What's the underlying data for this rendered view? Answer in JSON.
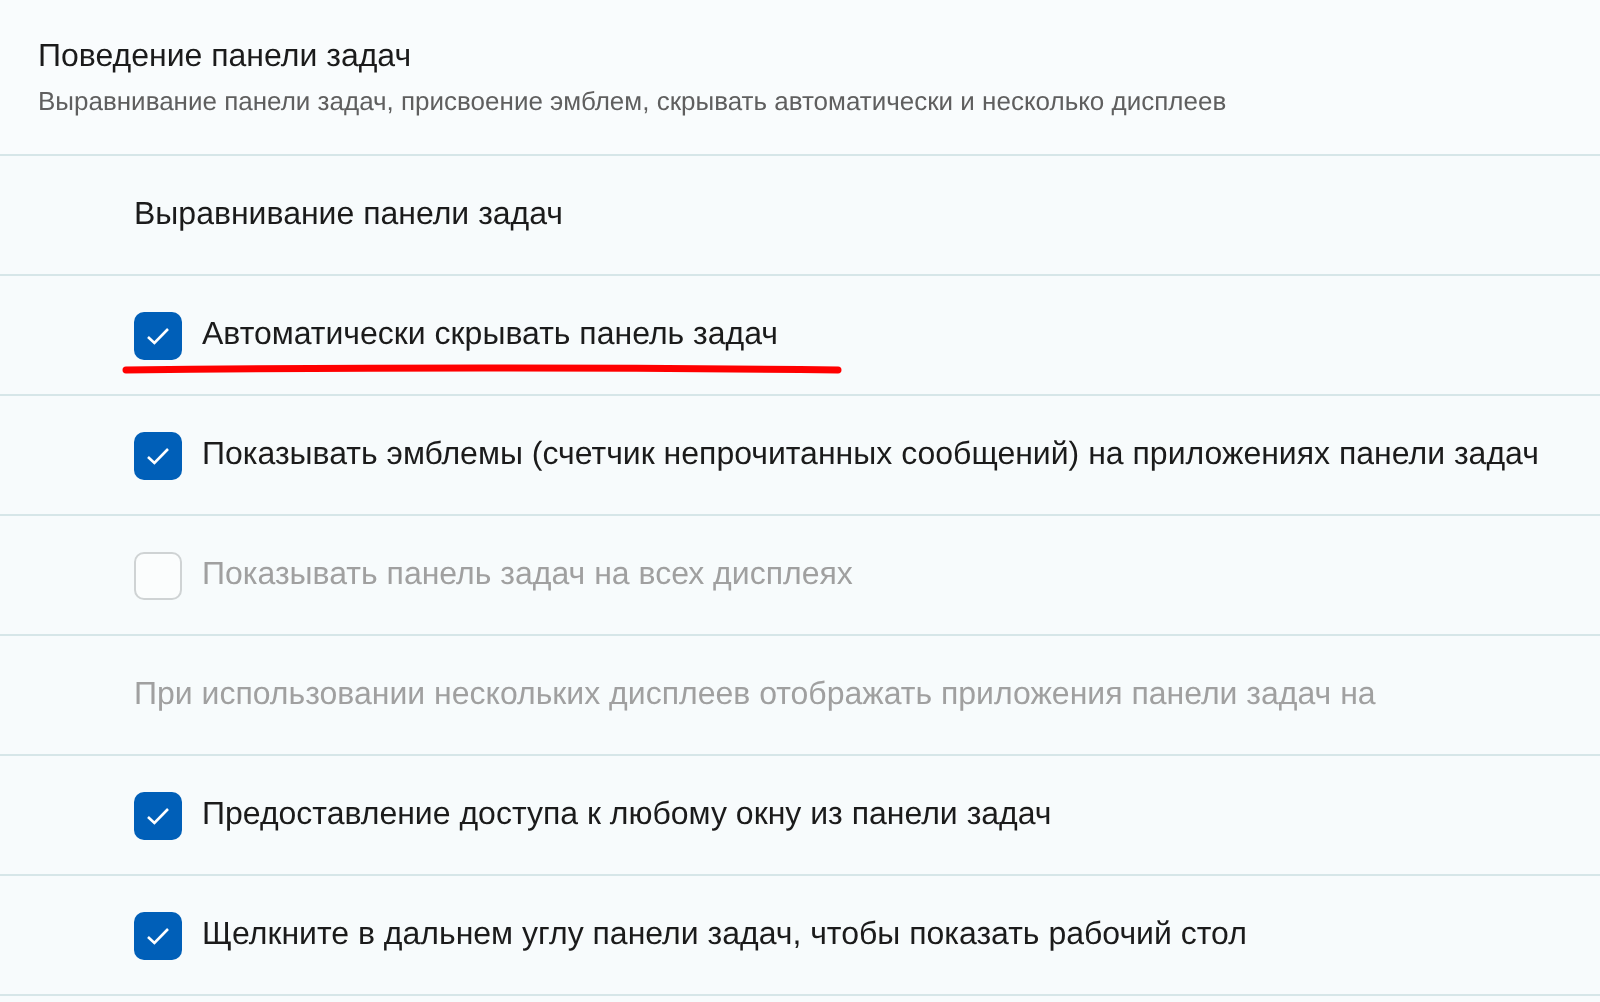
{
  "header": {
    "title": "Поведение панели задач",
    "subtitle": "Выравнивание панели задач, присвоение эмблем, скрывать автоматически и несколько дисплеев"
  },
  "rows": [
    {
      "kind": "label",
      "label": "Выравнивание панели задач",
      "disabled": false
    },
    {
      "kind": "checkbox",
      "label": "Автоматически скрывать панель задач",
      "checked": true,
      "disabled": false,
      "underlined": true
    },
    {
      "kind": "checkbox",
      "label": "Показывать эмблемы (счетчик непрочитанных сообщений) на приложениях панели задач",
      "checked": true,
      "disabled": false,
      "underlined": false
    },
    {
      "kind": "checkbox",
      "label": "Показывать панель задач на всех дисплеях",
      "checked": false,
      "disabled": true,
      "underlined": false
    },
    {
      "kind": "label",
      "label": "При использовании нескольких дисплеев отображать приложения панели задач на",
      "disabled": true
    },
    {
      "kind": "checkbox",
      "label": "Предоставление доступа к любому окну из панели задач",
      "checked": true,
      "disabled": false,
      "underlined": false
    },
    {
      "kind": "checkbox",
      "label": "Щелкните в дальнем углу панели задач, чтобы показать рабочий стол",
      "checked": true,
      "disabled": false,
      "underlined": false
    }
  ]
}
